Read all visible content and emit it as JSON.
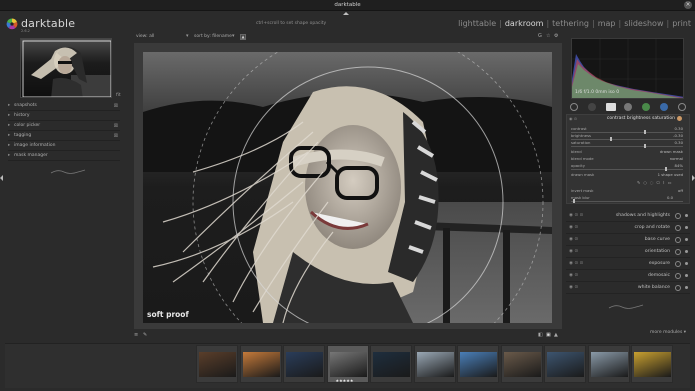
{
  "window": {
    "title": "darktable"
  },
  "header": {
    "brand": "darktable",
    "version": "2.6.2",
    "hint": "ctrl+scroll to set shape opacity",
    "views": [
      {
        "label": "lighttable",
        "active": false
      },
      {
        "label": "darkroom",
        "active": true
      },
      {
        "label": "tethering",
        "active": false
      },
      {
        "label": "map",
        "active": false
      },
      {
        "label": "slideshow",
        "active": false
      },
      {
        "label": "print",
        "active": false
      }
    ]
  },
  "left_panel": {
    "zoom": "fit",
    "modules": [
      {
        "label": "snapshots",
        "indicator": "⊠"
      },
      {
        "label": "history",
        "indicator": ""
      },
      {
        "label": "color picker",
        "indicator": "⊠"
      },
      {
        "label": "tagging",
        "indicator": "⊠"
      },
      {
        "label": "image information",
        "indicator": ""
      },
      {
        "label": "mask manager",
        "indicator": ""
      }
    ]
  },
  "center": {
    "view_filter": "view: all",
    "sort": "sort by: filename",
    "soft_proof_label": "soft proof"
  },
  "right_panel": {
    "histogram_info": "1/6 f/1.0 0mm iso 0",
    "active_module": {
      "title": "contrast brightness saturation",
      "rows": [
        {
          "label": "contrast",
          "value": "0.30",
          "pos": 0.65
        },
        {
          "label": "brightness",
          "value": "-0.30",
          "pos": 0.35
        },
        {
          "label": "saturation",
          "value": "0.30",
          "pos": 0.65
        },
        {
          "label": "blend",
          "value": "drawn mask"
        },
        {
          "label": "blend mode",
          "value": "normal"
        },
        {
          "label": "opacity",
          "value": "84%"
        },
        {
          "label": "drawn mask",
          "value": "1 shape used"
        },
        {
          "label": "invert mask",
          "value": "off"
        },
        {
          "label": "mask blur",
          "value": "0.0"
        }
      ]
    },
    "modules": [
      {
        "label": "shadows and highlights"
      },
      {
        "label": "crop and rotate"
      },
      {
        "label": "base curve"
      },
      {
        "label": "orientation"
      },
      {
        "label": "exposure"
      },
      {
        "label": "demosaic"
      },
      {
        "label": "white balance"
      }
    ],
    "more_modules": "more modules"
  },
  "filmstrip": {
    "selected_index": 3,
    "selected_stars": "★★★★★",
    "thumbs": [
      "#5a3e2a",
      "#c47a3a",
      "#2a3d5a",
      "#777",
      "#1e2e3e",
      "#9aa8b5",
      "#4a7fb8",
      "#6a5a4a",
      "#3d5570",
      "#8a9aa8",
      "#c8a030"
    ]
  },
  "colors": {
    "accent": "#d8d8d8",
    "panel_bg": "#2b2b2b",
    "canvas_bg": "#3a3a3a"
  }
}
